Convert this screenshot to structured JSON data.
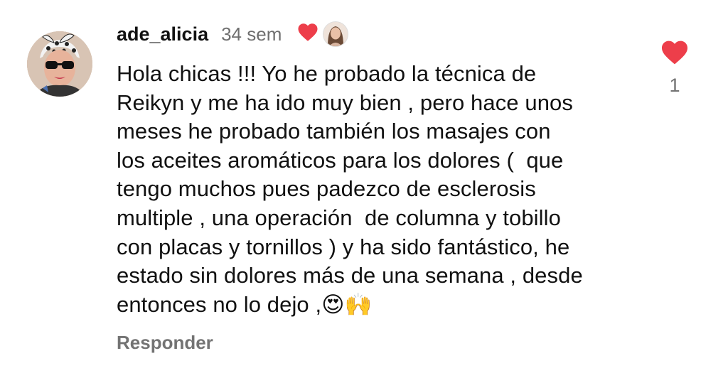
{
  "comment": {
    "username": "ade_alicia",
    "time": "34 sem",
    "creator_liked": true,
    "text": "Hola chicas !!! Yo he probado la técnica de\nReikyn y me ha ido muy bien , pero hace unos\nmeses he probado también los masajes con\nlos aceites aromáticos para los dolores (  que\ntengo muchos pues padezco de esclerosis\nmultiple , una operación  de columna y tobillo\ncon placas y tornillos ) y ha sido fantástico, he\nestado sin dolores más de una semana , desde\nentonces no lo dejo ,😍🙌",
    "reply_label": "Responder",
    "like_count": "1",
    "liked": true
  },
  "icons": {
    "like": "heart-icon",
    "creator_heart": "heart-icon",
    "avatar": "avatar",
    "creator_avatar": "avatar"
  },
  "colors": {
    "heart": "#ed3e4a",
    "muted_text": "#737373",
    "text": "#111111"
  }
}
